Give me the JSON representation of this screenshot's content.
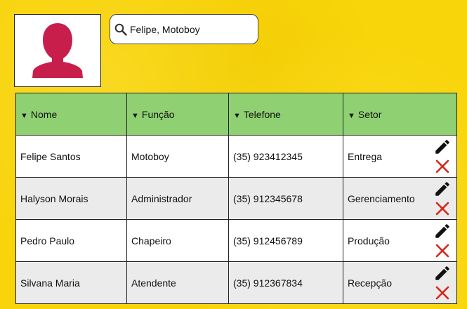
{
  "search": {
    "value": "Felipe, Motoboy"
  },
  "table": {
    "headers": [
      "Nome",
      "Função",
      "Telefone",
      "Setor"
    ],
    "rows": [
      {
        "nome": "Felipe Santos",
        "funcao": "Motoboy",
        "telefone": "(35) 923412345",
        "setor": "Entrega"
      },
      {
        "nome": "Halyson Morais",
        "funcao": "Administrador",
        "telefone": "(35) 912345678",
        "setor": "Gerenciamento"
      },
      {
        "nome": "Pedro Paulo",
        "funcao": "Chapeiro",
        "telefone": "(35) 912456789",
        "setor": "Produção"
      },
      {
        "nome": "Silvana Maria",
        "funcao": "Atendente",
        "telefone": "(35) 912367834",
        "setor": "Recepção"
      }
    ]
  },
  "icons": {
    "avatar": "user-silhouette-icon",
    "search": "search-icon",
    "sort": "sort-down-icon",
    "edit": "pencil-icon",
    "delete": "close-icon"
  },
  "colors": {
    "background": "#f8d40a",
    "header": "#8fd172",
    "avatar": "#c81e4b",
    "delete": "#d42a1e"
  }
}
